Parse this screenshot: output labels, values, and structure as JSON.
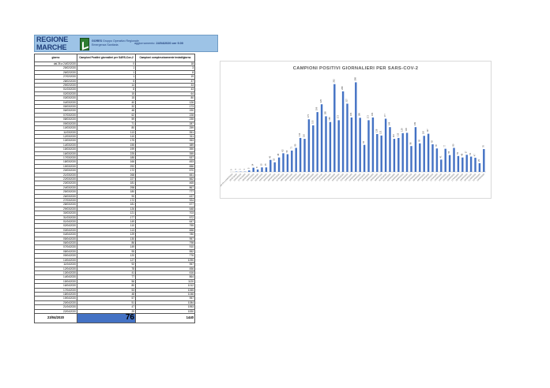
{
  "header": {
    "region_line1": "REGIONE",
    "region_line2": "MARCHE",
    "gores_name": "GORES",
    "gores_desc1": "Gruppo Operativo Regionale",
    "gores_desc2": "Emergenza Sanitaria",
    "update_label": "aggiornamento:",
    "update_value": "24/04/2020 ore 9.00"
  },
  "table": {
    "col_day": "giorno",
    "col_positive": "Campioni Positivi giornalieri per SARS-Cov-2",
    "col_tested": "Campioni complessivamente testati/giorno",
    "rows": [
      [
        "dal 26 a 24/02/2020",
        "0",
        "18"
      ],
      [
        "25/02/2020",
        "1",
        "3"
      ],
      [
        "26/02/2020",
        "1",
        "8"
      ],
      [
        "27/02/2020",
        "1",
        "19"
      ],
      [
        "28/02/2020",
        "5",
        "37"
      ],
      [
        "29/02/2020",
        "14",
        "33"
      ],
      [
        "01/03/2020",
        "8",
        "43"
      ],
      [
        "02/03/2020",
        "15",
        "64"
      ],
      [
        "03/03/2020",
        "15",
        "80"
      ],
      [
        "04/03/2020",
        "40",
        "126"
      ],
      [
        "05/03/2020",
        "32",
        "173"
      ],
      [
        "06/03/2020",
        "48",
        "190"
      ],
      [
        "07/03/2020",
        "62",
        "228"
      ],
      [
        "08/03/2020",
        "59",
        "235"
      ],
      [
        "09/03/2020",
        "71",
        "287"
      ],
      [
        "10/03/2020",
        "80",
        "259"
      ],
      [
        "11/03/2020",
        "113",
        "351"
      ],
      [
        "12/03/2020",
        "110",
        "311"
      ],
      [
        "13/03/2020",
        "175",
        "353"
      ],
      [
        "14/03/2020",
        "155",
        "389"
      ],
      [
        "15/03/2020",
        "199",
        "390"
      ],
      [
        "16/03/2020",
        "225",
        "355"
      ],
      [
        "17/03/2020",
        "185",
        "537"
      ],
      [
        "18/03/2020",
        "166",
        "453"
      ],
      [
        "19/03/2020",
        "292",
        "656"
      ],
      [
        "20/03/2020",
        "172",
        "570"
      ],
      [
        "21/03/2020",
        "268",
        "651"
      ],
      [
        "22/03/2020",
        "227",
        "662"
      ],
      [
        "23/03/2020",
        "181",
        "465"
      ],
      [
        "24/03/2020",
        "298",
        "867"
      ],
      [
        "25/03/2020",
        "180",
        "777"
      ],
      [
        "26/03/2020",
        "90",
        "437"
      ],
      [
        "27/03/2020",
        "172",
        "924"
      ],
      [
        "28/03/2020",
        "181",
        "577"
      ],
      [
        "29/03/2020",
        "126",
        "648"
      ],
      [
        "30/03/2020",
        "121",
        "703"
      ],
      [
        "31/03/2020",
        "177",
        "572"
      ],
      [
        "01/04/2020",
        "149",
        "647"
      ],
      [
        "02/04/2020",
        "110",
        "755"
      ],
      [
        "03/04/2020",
        "113",
        "658"
      ],
      [
        "04/04/2020",
        "129",
        "780"
      ],
      [
        "05/04/2020",
        "130",
        "957"
      ],
      [
        "06/04/2020",
        "86",
        "798"
      ],
      [
        "07/04/2020",
        "149",
        "910"
      ],
      [
        "08/04/2020",
        "95",
        "552"
      ],
      [
        "09/04/2020",
        "120",
        "776"
      ],
      [
        "10/04/2020",
        "127",
        "1090"
      ],
      [
        "11/04/2020",
        "92",
        "957"
      ],
      [
        "12/04/2020",
        "78",
        "456"
      ],
      [
        "13/04/2020",
        "41",
        "616"
      ],
      [
        "14/04/2020",
        "77",
        "864"
      ],
      [
        "15/04/2020",
        "56",
        "1120"
      ],
      [
        "16/04/2020",
        "80",
        "1012"
      ],
      [
        "17/04/2020",
        "53",
        "1065"
      ],
      [
        "18/04/2020",
        "48",
        "1046"
      ],
      [
        "19/04/2020",
        "57",
        "957"
      ],
      [
        "20/04/2020",
        "51",
        "1084"
      ],
      [
        "21/04/2020",
        "47",
        "1953"
      ],
      [
        "22/04/2020",
        "29",
        "1530"
      ]
    ],
    "total_date": "23/04/2020",
    "total_positive": "76",
    "total_tested": "1440"
  },
  "chart_data": {
    "type": "bar",
    "title": "CAMPIONI POSITIVI GIORNALIERI PER SARS-COV-2",
    "bar_color": "#4472C4",
    "categories": [
      "dal 26 a 24/02/2020",
      "25/02/2020",
      "26/02/2020",
      "27/02/2020",
      "28/02/2020",
      "29/02/2020",
      "01/03/2020",
      "02/03/2020",
      "03/03/2020",
      "04/03/2020",
      "05/03/2020",
      "06/03/2020",
      "07/03/2020",
      "08/03/2020",
      "09/03/2020",
      "10/03/2020",
      "11/03/2020",
      "12/03/2020",
      "13/03/2020",
      "14/03/2020",
      "15/03/2020",
      "16/03/2020",
      "17/03/2020",
      "18/03/2020",
      "19/03/2020",
      "20/03/2020",
      "21/03/2020",
      "22/03/2020",
      "23/03/2020",
      "24/03/2020",
      "25/03/2020",
      "26/03/2020",
      "27/03/2020",
      "28/03/2020",
      "29/03/2020",
      "30/03/2020",
      "31/03/2020",
      "01/04/2020",
      "02/04/2020",
      "03/04/2020",
      "04/04/2020",
      "05/04/2020",
      "06/04/2020",
      "07/04/2020",
      "08/04/2020",
      "09/04/2020",
      "10/04/2020",
      "11/04/2020",
      "12/04/2020",
      "13/04/2020",
      "14/04/2020",
      "15/04/2020",
      "16/04/2020",
      "17/04/2020",
      "18/04/2020",
      "19/04/2020",
      "20/04/2020",
      "21/04/2020",
      "22/04/2020",
      "23/04/2020"
    ],
    "values": [
      0,
      1,
      1,
      1,
      5,
      14,
      8,
      15,
      15,
      40,
      32,
      48,
      62,
      59,
      71,
      80,
      113,
      110,
      175,
      155,
      199,
      225,
      185,
      166,
      292,
      172,
      268,
      227,
      181,
      298,
      180,
      90,
      172,
      181,
      126,
      121,
      177,
      149,
      110,
      113,
      129,
      130,
      86,
      149,
      95,
      120,
      127,
      92,
      78,
      41,
      77,
      56,
      80,
      53,
      48,
      57,
      51,
      47,
      29,
      76
    ],
    "ylim": [
      0,
      320
    ],
    "grid": false,
    "legend": "none"
  }
}
